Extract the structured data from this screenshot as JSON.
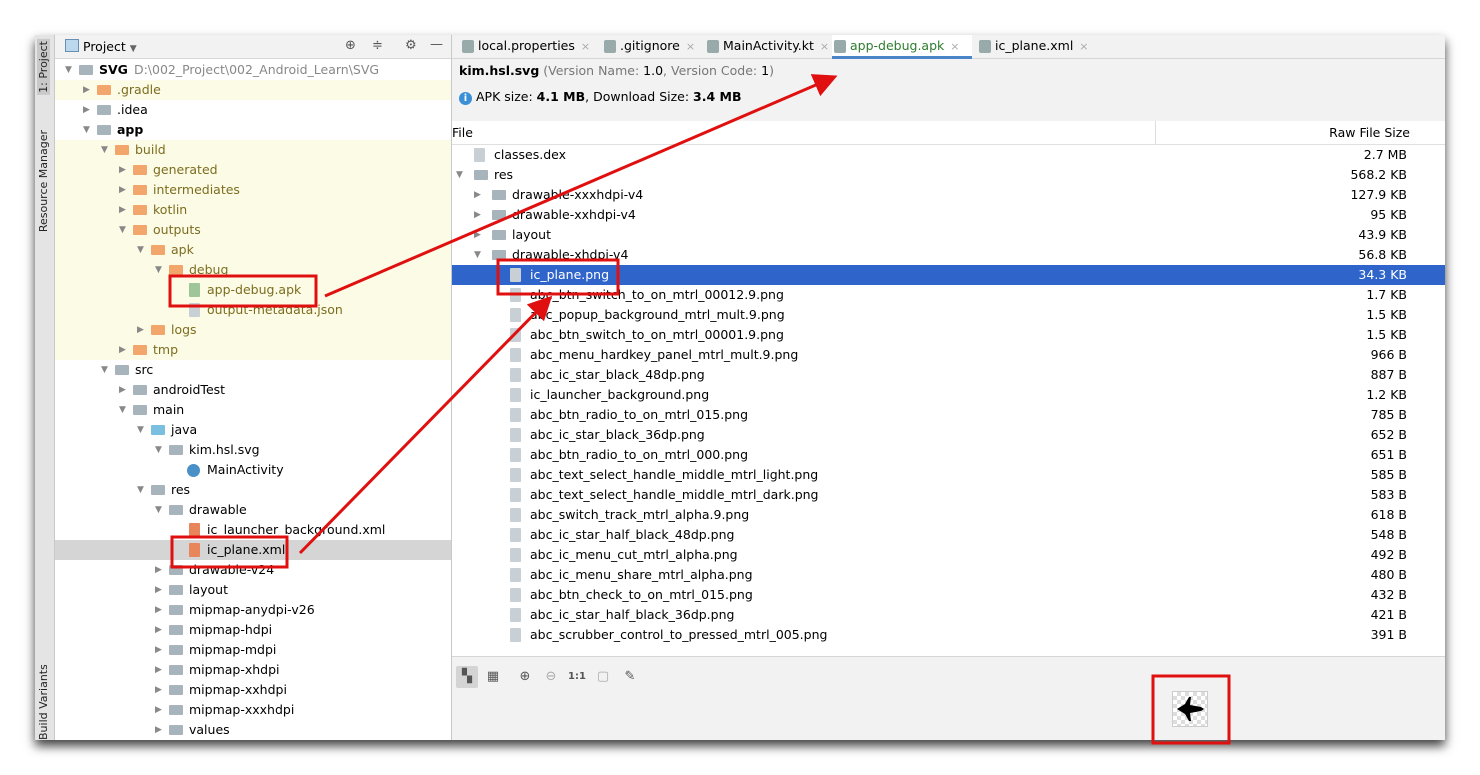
{
  "sidebar_tabs": {
    "project": "1: Project",
    "resource_manager": "Resource Manager",
    "build_variants": "Build Variants"
  },
  "project_panel": {
    "title": "Project",
    "tree": [
      {
        "label": "SVG",
        "path": "D:\\002_Project\\002_Android_Learn\\SVG",
        "level": 0,
        "arrow": "down",
        "icon": "module",
        "bold": true
      },
      {
        "label": ".gradle",
        "level": 1,
        "arrow": "right",
        "icon": "folder-orange",
        "yellow": true
      },
      {
        "label": ".idea",
        "level": 1,
        "arrow": "right",
        "icon": "folder-gray"
      },
      {
        "label": "app",
        "level": 1,
        "arrow": "down",
        "icon": "module",
        "bold": true
      },
      {
        "label": "build",
        "level": 2,
        "arrow": "down",
        "icon": "folder-orange",
        "yellow": true
      },
      {
        "label": "generated",
        "level": 3,
        "arrow": "right",
        "icon": "folder-orange",
        "yellow": true
      },
      {
        "label": "intermediates",
        "level": 3,
        "arrow": "right",
        "icon": "folder-orange",
        "yellow": true
      },
      {
        "label": "kotlin",
        "level": 3,
        "arrow": "right",
        "icon": "folder-orange",
        "yellow": true
      },
      {
        "label": "outputs",
        "level": 3,
        "arrow": "down",
        "icon": "folder-orange",
        "yellow": true
      },
      {
        "label": "apk",
        "level": 4,
        "arrow": "down",
        "icon": "folder-orange",
        "yellow": true
      },
      {
        "label": "debug",
        "level": 5,
        "arrow": "down",
        "icon": "folder-orange",
        "yellow": true
      },
      {
        "label": "app-debug.apk",
        "level": 6,
        "icon": "apk-file",
        "yellow": true
      },
      {
        "label": "output-metadata.json",
        "level": 6,
        "icon": "json-file",
        "yellow": true
      },
      {
        "label": "logs",
        "level": 4,
        "arrow": "right",
        "icon": "folder-orange",
        "yellow": true
      },
      {
        "label": "tmp",
        "level": 3,
        "arrow": "right",
        "icon": "folder-orange",
        "yellow": true
      },
      {
        "label": "src",
        "level": 2,
        "arrow": "down",
        "icon": "folder-gray"
      },
      {
        "label": "androidTest",
        "level": 3,
        "arrow": "right",
        "icon": "folder-gray"
      },
      {
        "label": "main",
        "level": 3,
        "arrow": "down",
        "icon": "folder-gray"
      },
      {
        "label": "java",
        "level": 4,
        "arrow": "down",
        "icon": "folder-blue"
      },
      {
        "label": "kim.hsl.svg",
        "level": 5,
        "arrow": "down",
        "icon": "package"
      },
      {
        "label": "MainActivity",
        "level": 6,
        "icon": "kotlin-class"
      },
      {
        "label": "res",
        "level": 4,
        "arrow": "down",
        "icon": "folder-res"
      },
      {
        "label": "drawable",
        "level": 5,
        "arrow": "down",
        "icon": "folder-gray"
      },
      {
        "label": "ic_launcher_background.xml",
        "level": 6,
        "icon": "xml-file"
      },
      {
        "label": "ic_plane.xml",
        "level": 6,
        "icon": "xml-file",
        "selected": true
      },
      {
        "label": "drawable-v24",
        "level": 5,
        "arrow": "right",
        "icon": "folder-gray"
      },
      {
        "label": "layout",
        "level": 5,
        "arrow": "right",
        "icon": "folder-gray"
      },
      {
        "label": "mipmap-anydpi-v26",
        "level": 5,
        "arrow": "right",
        "icon": "folder-gray"
      },
      {
        "label": "mipmap-hdpi",
        "level": 5,
        "arrow": "right",
        "icon": "folder-gray"
      },
      {
        "label": "mipmap-mdpi",
        "level": 5,
        "arrow": "right",
        "icon": "folder-gray"
      },
      {
        "label": "mipmap-xhdpi",
        "level": 5,
        "arrow": "right",
        "icon": "folder-gray"
      },
      {
        "label": "mipmap-xxhdpi",
        "level": 5,
        "arrow": "right",
        "icon": "folder-gray"
      },
      {
        "label": "mipmap-xxxhdpi",
        "level": 5,
        "arrow": "right",
        "icon": "folder-gray"
      },
      {
        "label": "values",
        "level": 5,
        "arrow": "right",
        "icon": "folder-gray"
      }
    ]
  },
  "tabs": [
    {
      "label": "local.properties"
    },
    {
      "label": ".gitignore"
    },
    {
      "label": "MainActivity.kt"
    },
    {
      "label": "app-debug.apk",
      "active": true
    },
    {
      "label": "ic_plane.xml"
    }
  ],
  "apk_info": {
    "package": "kim.hsl.svg",
    "version_name_label": "(Version Name: ",
    "version_name": "1.0",
    "version_code_label": ", Version Code: ",
    "version_code": "1",
    "close_paren": ")",
    "apk_size_label": "APK size: ",
    "apk_size": "4.1 MB",
    "download_label": ", Download Size: ",
    "download_size": "3.4 MB"
  },
  "table": {
    "col_file": "File",
    "col_size": "Raw File Size",
    "rows": [
      {
        "name": "classes.dex",
        "size": "2.7 MB",
        "level": 0,
        "icon": "dex"
      },
      {
        "name": "res",
        "size": "568.2 KB",
        "level": 0,
        "arrow": "down",
        "icon": "folder"
      },
      {
        "name": "drawable-xxxhdpi-v4",
        "size": "127.9 KB",
        "level": 1,
        "arrow": "right",
        "icon": "folder"
      },
      {
        "name": "drawable-xxhdpi-v4",
        "size": "95 KB",
        "level": 1,
        "arrow": "right",
        "icon": "folder"
      },
      {
        "name": "layout",
        "size": "43.9 KB",
        "level": 1,
        "arrow": "right",
        "icon": "folder"
      },
      {
        "name": "drawable-xhdpi-v4",
        "size": "56.8 KB",
        "level": 1,
        "arrow": "down",
        "icon": "folder"
      },
      {
        "name": "ic_plane.png",
        "size": "34.3 KB",
        "level": 2,
        "icon": "file",
        "selected": true
      },
      {
        "name": "abc_btn_switch_to_on_mtrl_00012.9.png",
        "size": "1.7 KB",
        "level": 2,
        "icon": "file"
      },
      {
        "name": "abc_popup_background_mtrl_mult.9.png",
        "size": "1.5 KB",
        "level": 2,
        "icon": "file"
      },
      {
        "name": "abc_btn_switch_to_on_mtrl_00001.9.png",
        "size": "1.5 KB",
        "level": 2,
        "icon": "file"
      },
      {
        "name": "abc_menu_hardkey_panel_mtrl_mult.9.png",
        "size": "966 B",
        "level": 2,
        "icon": "file"
      },
      {
        "name": "abc_ic_star_black_48dp.png",
        "size": "887 B",
        "level": 2,
        "icon": "file"
      },
      {
        "name": "ic_launcher_background.png",
        "size": "1.2 KB",
        "level": 2,
        "icon": "file"
      },
      {
        "name": "abc_btn_radio_to_on_mtrl_015.png",
        "size": "785 B",
        "level": 2,
        "icon": "file"
      },
      {
        "name": "abc_ic_star_black_36dp.png",
        "size": "652 B",
        "level": 2,
        "icon": "file"
      },
      {
        "name": "abc_btn_radio_to_on_mtrl_000.png",
        "size": "651 B",
        "level": 2,
        "icon": "file"
      },
      {
        "name": "abc_text_select_handle_middle_mtrl_light.png",
        "size": "585 B",
        "level": 2,
        "icon": "file"
      },
      {
        "name": "abc_text_select_handle_middle_mtrl_dark.png",
        "size": "583 B",
        "level": 2,
        "icon": "file"
      },
      {
        "name": "abc_switch_track_mtrl_alpha.9.png",
        "size": "618 B",
        "level": 2,
        "icon": "file"
      },
      {
        "name": "abc_ic_star_half_black_48dp.png",
        "size": "548 B",
        "level": 2,
        "icon": "file"
      },
      {
        "name": "abc_ic_menu_cut_mtrl_alpha.png",
        "size": "492 B",
        "level": 2,
        "icon": "file"
      },
      {
        "name": "abc_ic_menu_share_mtrl_alpha.png",
        "size": "480 B",
        "level": 2,
        "icon": "file"
      },
      {
        "name": "abc_btn_check_to_on_mtrl_015.png",
        "size": "432 B",
        "level": 2,
        "icon": "file"
      },
      {
        "name": "abc_ic_star_half_black_36dp.png",
        "size": "421 B",
        "level": 2,
        "icon": "file"
      },
      {
        "name": "abc_scrubber_control_to_pressed_mtrl_005.png",
        "size": "391 B",
        "level": 2,
        "icon": "file"
      }
    ]
  },
  "image_toolbar": {
    "actual_size": "1:1"
  },
  "colors": {
    "selection": "#2f65ca",
    "annotation": "#e01010",
    "excluded_bg": "#fcfbe6"
  }
}
